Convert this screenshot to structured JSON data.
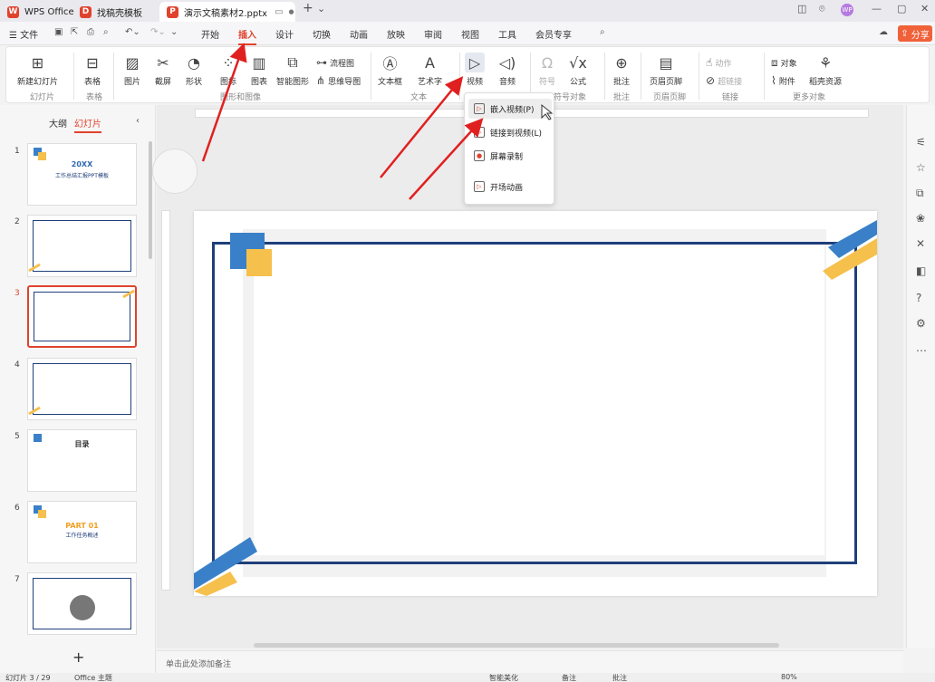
{
  "titlebar": {
    "tabs": [
      {
        "label": "WPS Office"
      },
      {
        "label": "找稿壳模板"
      },
      {
        "label": "演示文稿素材2.pptx"
      }
    ],
    "add_tab": "+",
    "avatar": "WP"
  },
  "menubar": {
    "file": "文件",
    "items": [
      "开始",
      "插入",
      "设计",
      "切换",
      "动画",
      "放映",
      "审阅",
      "视图",
      "工具",
      "会员专享"
    ],
    "active": "插入",
    "share": "分享"
  },
  "ribbon": {
    "new_slide": "新建幻灯片",
    "table": "表格",
    "picture": "图片",
    "screenshot": "截屏",
    "shape": "形状",
    "icon": "图标",
    "chart": "图表",
    "smart_art": "智能图形",
    "flowchart": "流程图",
    "mindmap": "思维导图",
    "textbox": "文本框",
    "wordart": "艺术字",
    "video": "视频",
    "audio": "音频",
    "symbol": "符号",
    "formula": "公式",
    "comment": "批注",
    "header_footer": "页眉页脚",
    "action": "动作",
    "hyperlink": "超链接",
    "object": "对象",
    "attachment": "附件",
    "resources": "稻壳资源",
    "groups": {
      "slides": "幻灯片",
      "table": "表格",
      "graphics": "图形和图像",
      "text": "文本",
      "symbol": "符号对象",
      "comment": "批注",
      "header": "页眉页脚",
      "link": "链接",
      "more": "更多对象"
    }
  },
  "video_menu": {
    "items": [
      "嵌入视频(P)",
      "链接到视频(L)",
      "屏幕录制",
      "开场动画"
    ]
  },
  "left_panel": {
    "tab_outline": "大纲",
    "tab_slides": "幻灯片",
    "selected_slide": 3,
    "slides": [
      {
        "num": "1",
        "title": "20XX",
        "subtitle": "工作总结汇报PPT模板"
      },
      {
        "num": "2",
        "title": "",
        "subtitle": ""
      },
      {
        "num": "3",
        "title": "",
        "subtitle": ""
      },
      {
        "num": "4",
        "title": "",
        "subtitle": ""
      },
      {
        "num": "5",
        "title": "目录",
        "subtitle": ""
      },
      {
        "num": "6",
        "title": "PART 01",
        "subtitle": "工作任务概述"
      },
      {
        "num": "7",
        "title": "",
        "subtitle": ""
      }
    ],
    "add_button": "+"
  },
  "notes": {
    "placeholder": "单击此处添加备注"
  },
  "status": {
    "slide_info": "幻灯片 3 / 29",
    "theme": "Office 主题",
    "smart_beautify": "智能美化",
    "notes": "备注",
    "comments": "批注",
    "zoom": "80%"
  },
  "colors": {
    "accent": "#e0432d",
    "navy": "#1f3f7a",
    "blue": "#3a80c8",
    "yellow": "#f6c04d"
  }
}
